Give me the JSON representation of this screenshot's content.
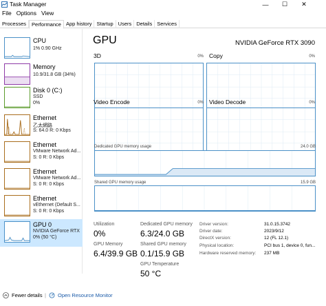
{
  "window": {
    "title": "Task Manager",
    "minimize": "—",
    "maximize": "☐",
    "close": "✕"
  },
  "menu": [
    "File",
    "Options",
    "View"
  ],
  "tabs": [
    "Processes",
    "Performance",
    "App history",
    "Startup",
    "Users",
    "Details",
    "Services"
  ],
  "active_tab": 1,
  "sidebar": [
    {
      "title": "CPU",
      "lines": [
        "1% 0.90 GHz"
      ]
    },
    {
      "title": "Memory",
      "lines": [
        "10.9/31.8 GB (34%)"
      ]
    },
    {
      "title": "Disk 0 (C:)",
      "lines": [
        "SSD",
        "0%"
      ]
    },
    {
      "title": "Ethernet",
      "lines": [
        "乙太網路",
        "S: 64.0 R: 0 Kbps"
      ]
    },
    {
      "title": "Ethernet",
      "lines": [
        "VMware Network Ad...",
        "S: 0 R: 0 Kbps"
      ]
    },
    {
      "title": "Ethernet",
      "lines": [
        "VMware Network Ad...",
        "S: 0 R: 0 Kbps"
      ]
    },
    {
      "title": "Ethernet",
      "lines": [
        "vEthernet (Default S...",
        "S: 0 R: 0 Kbps"
      ]
    },
    {
      "title": "GPU 0",
      "lines": [
        "NVIDIA GeForce RTX",
        "0% (50 °C)"
      ]
    }
  ],
  "selected_sidebar": 7,
  "gpu": {
    "title": "GPU",
    "name": "NVIDIA GeForce RTX 3090",
    "engines": [
      {
        "label": "3D",
        "pct": "0%"
      },
      {
        "label": "Copy",
        "pct": "0%"
      },
      {
        "label": "Video Encode",
        "pct": "0%"
      },
      {
        "label": "Video Decode",
        "pct": "0%"
      }
    ],
    "dedicated_label": "Dedicated GPU memory usage",
    "dedicated_max": "24.0 GB",
    "shared_label": "Shared GPU memory usage",
    "shared_max": "15.9 GB"
  },
  "stats": {
    "utilization": {
      "label": "Utilization",
      "value": "0%"
    },
    "dedicated": {
      "label": "Dedicated GPU memory",
      "value": "6.3/24.0 GB"
    },
    "gpu_memory": {
      "label": "GPU Memory",
      "value": "6.4/39.9 GB"
    },
    "shared": {
      "label": "Shared GPU memory",
      "value": "0.1/15.9 GB"
    },
    "temperature": {
      "label": "GPU Temperature",
      "value": "50 °C"
    }
  },
  "info": [
    {
      "label": "Driver version:",
      "value": "31.0.15.3742"
    },
    {
      "label": "Driver date:",
      "value": "2023/9/12"
    },
    {
      "label": "DirectX version:",
      "value": "12 (FL 12.1)"
    },
    {
      "label": "Physical location:",
      "value": "PCI bus 1, device 0, fun..."
    },
    {
      "label": "Hardware reserved memory:",
      "value": "237 MB"
    }
  ],
  "footer": {
    "fewer_details": "Fewer details",
    "separator": "|",
    "resource_monitor": "Open Resource Monitor"
  },
  "colors": {
    "accent": "#4a90c7",
    "selected": "#cce8ff",
    "memory": "#8e3aa7",
    "disk": "#5a9a2a",
    "ethernet": "#a96d1c"
  }
}
